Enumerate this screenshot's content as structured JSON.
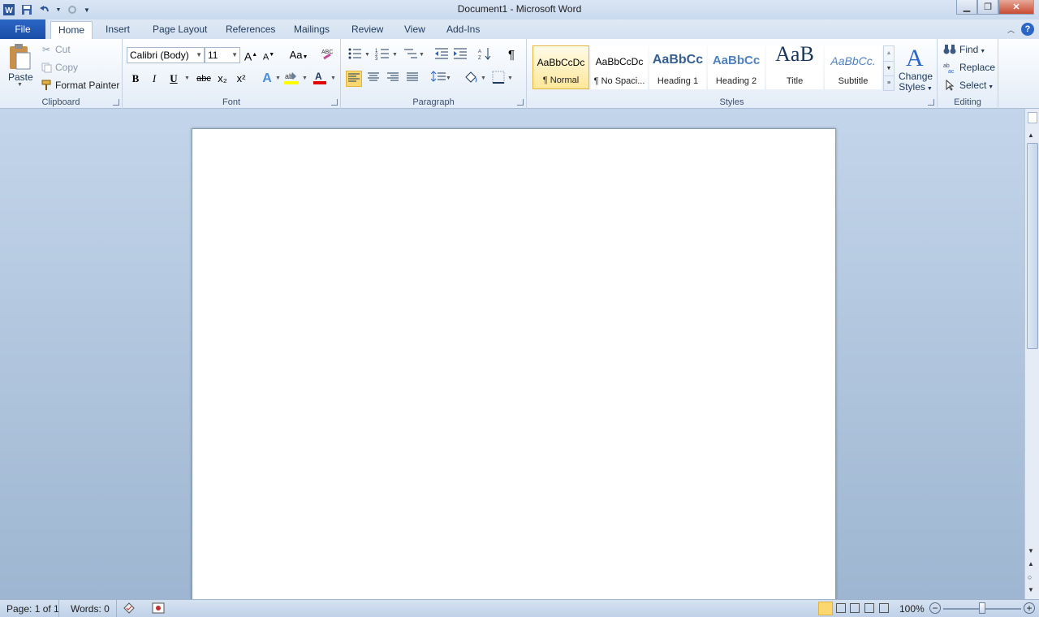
{
  "window": {
    "title": "Document1  -  Microsoft Word"
  },
  "qat": {
    "app_icon": "word-icon",
    "save": "save-icon",
    "undo": "undo-icon",
    "redo": "redo-icon",
    "customize": "dropdown-icon"
  },
  "tabs": [
    {
      "label": "File"
    },
    {
      "label": "Home"
    },
    {
      "label": "Insert"
    },
    {
      "label": "Page Layout"
    },
    {
      "label": "References"
    },
    {
      "label": "Mailings"
    },
    {
      "label": "Review"
    },
    {
      "label": "View"
    },
    {
      "label": "Add-Ins"
    }
  ],
  "clipboard": {
    "paste": "Paste",
    "cut": "Cut",
    "copy": "Copy",
    "format_painter": "Format Painter",
    "group_label": "Clipboard"
  },
  "font": {
    "name": "Calibri (Body)",
    "size": "11",
    "group_label": "Font",
    "bold": "B",
    "italic": "I",
    "underline": "U",
    "strike": "abc",
    "subscript": "x₂",
    "superscript": "x²",
    "change_case": "Aa",
    "grow": "A",
    "shrink": "A",
    "highlight_color": "#ffff00",
    "font_color": "#e00000"
  },
  "paragraph": {
    "group_label": "Paragraph",
    "pilcrow": "¶"
  },
  "styles": {
    "group_label": "Styles",
    "items": [
      {
        "preview": "AaBbCcDc",
        "label": "¶ Normal"
      },
      {
        "preview": "AaBbCcDc",
        "label": "¶ No Spaci..."
      },
      {
        "preview": "AaBbCc",
        "label": "Heading 1"
      },
      {
        "preview": "AaBbCc",
        "label": "Heading 2"
      },
      {
        "preview": "AaB",
        "label": "Title"
      },
      {
        "preview": "AaBbCc.",
        "label": "Subtitle"
      }
    ],
    "change_styles_line1": "Change",
    "change_styles_line2": "Styles"
  },
  "editing": {
    "find": "Find",
    "replace": "Replace",
    "select": "Select",
    "group_label": "Editing"
  },
  "status": {
    "page": "Page: 1 of 1",
    "words": "Words: 0",
    "zoom": "100%"
  }
}
